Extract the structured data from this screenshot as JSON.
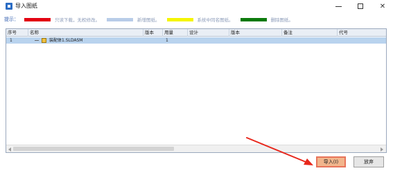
{
  "window": {
    "title": "导入图纸",
    "minimize_label": "–",
    "maximize_label": "□",
    "close_label": "✕"
  },
  "hint": {
    "label": "提示：",
    "items": [
      {
        "color": "#e30010",
        "text": "只读下载，无权修改。"
      },
      {
        "color": "#b8cce8",
        "text": "新增图纸。"
      },
      {
        "color": "#f5f500",
        "text": "系统中同名图纸。"
      },
      {
        "color": "#0a7a0a",
        "text": "删除图纸。"
      }
    ]
  },
  "table": {
    "columns": [
      "序号",
      "名称",
      "版本",
      "用量",
      "设计",
      "版本",
      "备注",
      "代号"
    ],
    "rows": [
      {
        "index": "1",
        "name": "装配体1.SLDASM",
        "version": "",
        "quantity": "1",
        "design": "",
        "version2": "",
        "remark": "",
        "code": ""
      }
    ]
  },
  "buttons": {
    "import": "导入(I)",
    "cancel": "放弃"
  },
  "colors": {
    "selected_row": "#b9d3ee",
    "annotation_arrow": "#e8271c"
  }
}
